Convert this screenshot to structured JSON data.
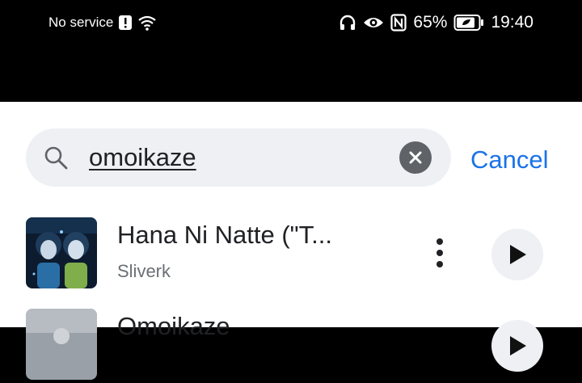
{
  "status_bar": {
    "carrier": "No service",
    "battery_percent": "65%",
    "time": "19:40",
    "icons": [
      "alert-icon",
      "wifi-icon",
      "headphones-icon",
      "eye-icon",
      "nfc-icon",
      "battery-icon"
    ]
  },
  "search": {
    "query": "omoikaze",
    "cancel_label": "Cancel"
  },
  "results": [
    {
      "title": "Hana Ni Natte (\"T...",
      "artist": "Sliverk"
    },
    {
      "title": "Omoikaze",
      "artist": ""
    }
  ],
  "colors": {
    "accent": "#1a73e8",
    "search_bg": "#eef0f4"
  }
}
